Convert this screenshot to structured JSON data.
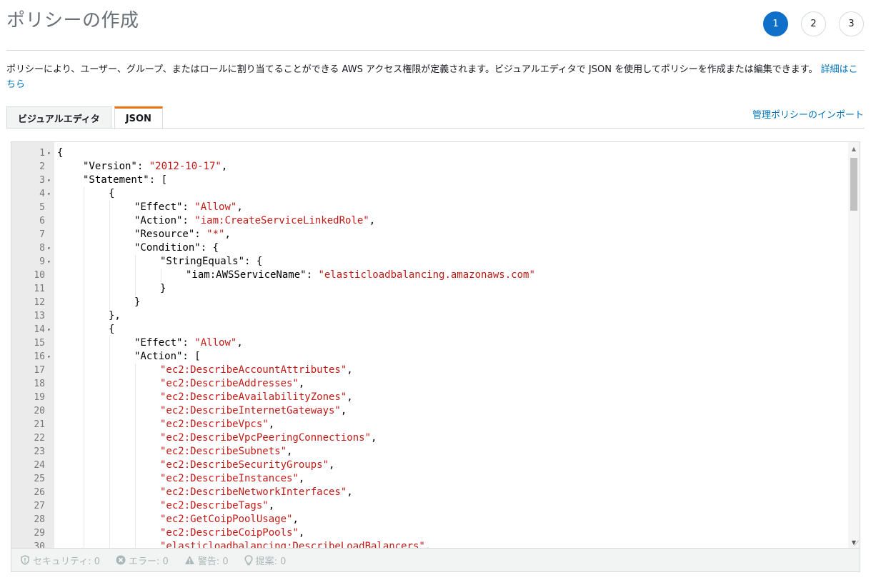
{
  "page": {
    "title": "ポリシーの作成",
    "steps": [
      "1",
      "2",
      "3"
    ],
    "description": "ポリシーにより、ユーザー、グループ、またはロールに割り当てることができる AWS アクセス権限が定義されます。ビジュアルエディタで JSON を使用してポリシーを作成または編集できます。",
    "learn_more": "詳細はこちら"
  },
  "tabs": [
    {
      "label": "ビジュアルエディタ",
      "active": false
    },
    {
      "label": "JSON",
      "active": true
    }
  ],
  "import_link": "管理ポリシーのインポート",
  "editor": {
    "lines": [
      {
        "n": "1",
        "fold": true,
        "indent": 0,
        "parts": [
          [
            "k",
            "{"
          ]
        ]
      },
      {
        "n": "2",
        "fold": false,
        "indent": 1,
        "parts": [
          [
            "k",
            "\"Version\": "
          ],
          [
            "s",
            "\"2012-10-17\""
          ],
          [
            "k",
            ","
          ]
        ]
      },
      {
        "n": "3",
        "fold": true,
        "indent": 1,
        "parts": [
          [
            "k",
            "\"Statement\": ["
          ]
        ]
      },
      {
        "n": "4",
        "fold": true,
        "indent": 2,
        "parts": [
          [
            "k",
            "{"
          ]
        ]
      },
      {
        "n": "5",
        "fold": false,
        "indent": 3,
        "parts": [
          [
            "k",
            "\"Effect\": "
          ],
          [
            "s",
            "\"Allow\""
          ],
          [
            "k",
            ","
          ]
        ]
      },
      {
        "n": "6",
        "fold": false,
        "indent": 3,
        "parts": [
          [
            "k",
            "\"Action\": "
          ],
          [
            "s",
            "\"iam:CreateServiceLinkedRole\""
          ],
          [
            "k",
            ","
          ]
        ]
      },
      {
        "n": "7",
        "fold": false,
        "indent": 3,
        "parts": [
          [
            "k",
            "\"Resource\": "
          ],
          [
            "s",
            "\"*\""
          ],
          [
            "k",
            ","
          ]
        ]
      },
      {
        "n": "8",
        "fold": true,
        "indent": 3,
        "parts": [
          [
            "k",
            "\"Condition\": {"
          ]
        ]
      },
      {
        "n": "9",
        "fold": true,
        "indent": 4,
        "parts": [
          [
            "k",
            "\"StringEquals\": {"
          ]
        ]
      },
      {
        "n": "10",
        "fold": false,
        "indent": 5,
        "parts": [
          [
            "k",
            "\"iam:AWSServiceName\": "
          ],
          [
            "s",
            "\"elasticloadbalancing.amazonaws.com\""
          ]
        ]
      },
      {
        "n": "11",
        "fold": false,
        "indent": 4,
        "parts": [
          [
            "k",
            "}"
          ]
        ]
      },
      {
        "n": "12",
        "fold": false,
        "indent": 3,
        "parts": [
          [
            "k",
            "}"
          ]
        ]
      },
      {
        "n": "13",
        "fold": false,
        "indent": 2,
        "parts": [
          [
            "k",
            "},"
          ]
        ]
      },
      {
        "n": "14",
        "fold": true,
        "indent": 2,
        "parts": [
          [
            "k",
            "{"
          ]
        ]
      },
      {
        "n": "15",
        "fold": false,
        "indent": 3,
        "parts": [
          [
            "k",
            "\"Effect\": "
          ],
          [
            "s",
            "\"Allow\""
          ],
          [
            "k",
            ","
          ]
        ]
      },
      {
        "n": "16",
        "fold": true,
        "indent": 3,
        "parts": [
          [
            "k",
            "\"Action\": ["
          ]
        ]
      },
      {
        "n": "17",
        "fold": false,
        "indent": 4,
        "parts": [
          [
            "s",
            "\"ec2:DescribeAccountAttributes\""
          ],
          [
            "k",
            ","
          ]
        ]
      },
      {
        "n": "18",
        "fold": false,
        "indent": 4,
        "parts": [
          [
            "s",
            "\"ec2:DescribeAddresses\""
          ],
          [
            "k",
            ","
          ]
        ]
      },
      {
        "n": "19",
        "fold": false,
        "indent": 4,
        "parts": [
          [
            "s",
            "\"ec2:DescribeAvailabilityZones\""
          ],
          [
            "k",
            ","
          ]
        ]
      },
      {
        "n": "20",
        "fold": false,
        "indent": 4,
        "parts": [
          [
            "s",
            "\"ec2:DescribeInternetGateways\""
          ],
          [
            "k",
            ","
          ]
        ]
      },
      {
        "n": "21",
        "fold": false,
        "indent": 4,
        "parts": [
          [
            "s",
            "\"ec2:DescribeVpcs\""
          ],
          [
            "k",
            ","
          ]
        ]
      },
      {
        "n": "22",
        "fold": false,
        "indent": 4,
        "parts": [
          [
            "s",
            "\"ec2:DescribeVpcPeeringConnections\""
          ],
          [
            "k",
            ","
          ]
        ]
      },
      {
        "n": "23",
        "fold": false,
        "indent": 4,
        "parts": [
          [
            "s",
            "\"ec2:DescribeSubnets\""
          ],
          [
            "k",
            ","
          ]
        ]
      },
      {
        "n": "24",
        "fold": false,
        "indent": 4,
        "parts": [
          [
            "s",
            "\"ec2:DescribeSecurityGroups\""
          ],
          [
            "k",
            ","
          ]
        ]
      },
      {
        "n": "25",
        "fold": false,
        "indent": 4,
        "parts": [
          [
            "s",
            "\"ec2:DescribeInstances\""
          ],
          [
            "k",
            ","
          ]
        ]
      },
      {
        "n": "26",
        "fold": false,
        "indent": 4,
        "parts": [
          [
            "s",
            "\"ec2:DescribeNetworkInterfaces\""
          ],
          [
            "k",
            ","
          ]
        ]
      },
      {
        "n": "27",
        "fold": false,
        "indent": 4,
        "parts": [
          [
            "s",
            "\"ec2:DescribeTags\""
          ],
          [
            "k",
            ","
          ]
        ]
      },
      {
        "n": "28",
        "fold": false,
        "indent": 4,
        "parts": [
          [
            "s",
            "\"ec2:GetCoipPoolUsage\""
          ],
          [
            "k",
            ","
          ]
        ]
      },
      {
        "n": "29",
        "fold": false,
        "indent": 4,
        "parts": [
          [
            "s",
            "\"ec2:DescribeCoipPools\""
          ],
          [
            "k",
            ","
          ]
        ]
      },
      {
        "n": "30",
        "fold": false,
        "indent": 4,
        "parts": [
          [
            "s",
            "\"elasticloadbalancing:DescribeLoadBalancers\""
          ],
          [
            "k",
            ","
          ]
        ]
      }
    ]
  },
  "status": [
    {
      "icon": "shield-icon",
      "label": "セキュリティ: 0"
    },
    {
      "icon": "error-icon",
      "label": "エラー: 0"
    },
    {
      "icon": "warning-icon",
      "label": "警告: 0"
    },
    {
      "icon": "lightbulb-icon",
      "label": "提案: 0"
    }
  ]
}
